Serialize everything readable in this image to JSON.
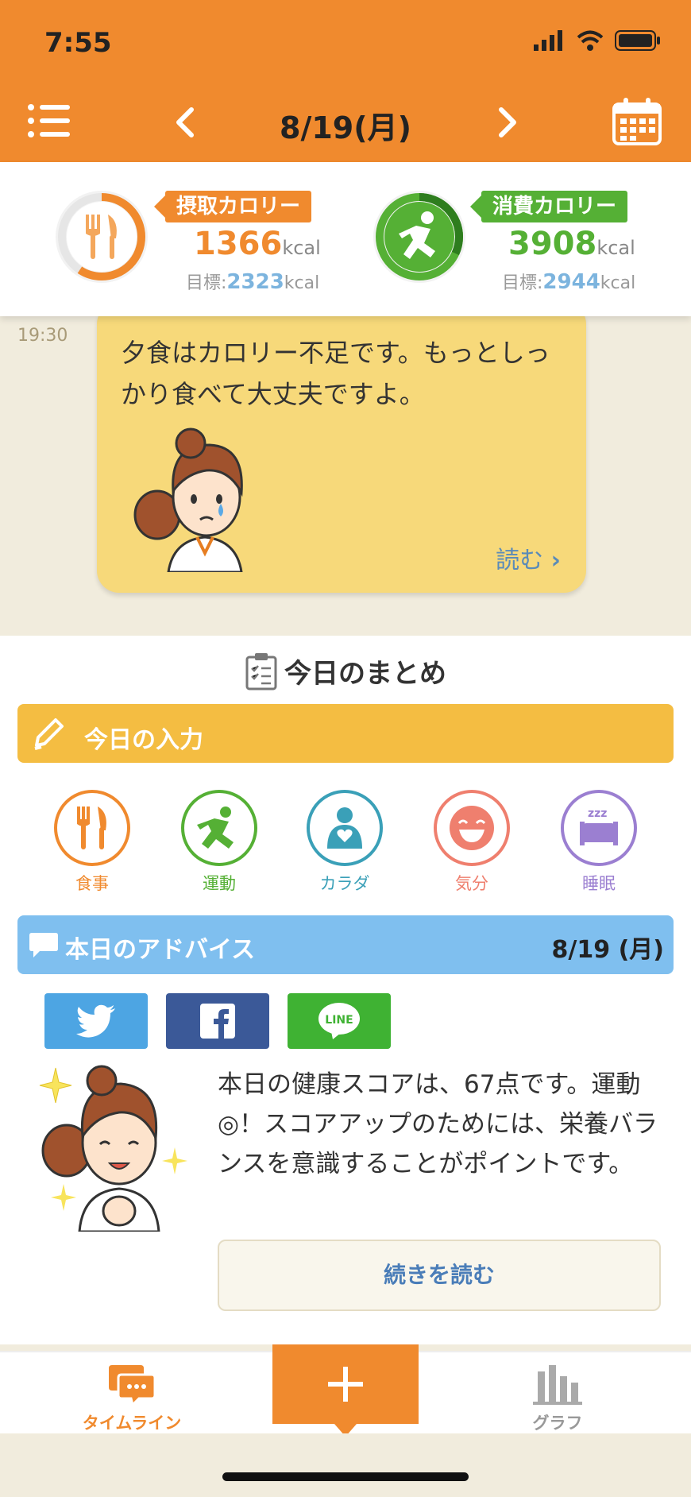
{
  "status_bar": {
    "time": "7:55"
  },
  "nav": {
    "title": "8/19(月)"
  },
  "calories": {
    "intake": {
      "label": "摂取カロリー",
      "value": "1366",
      "unit": "kcal",
      "goal_prefix": "目標:",
      "goal_value": "2323",
      "goal_unit": "kcal"
    },
    "burned": {
      "label": "消費カロリー",
      "value": "3908",
      "unit": "kcal",
      "goal_prefix": "目標:",
      "goal_value": "2944",
      "goal_unit": "kcal"
    }
  },
  "timeline": {
    "time": "19:30",
    "message": "夕食はカロリー不足です。もっとしっかり食べて大丈夫ですよ。",
    "read_more": "読む"
  },
  "summary": {
    "title": "今日のまとめ",
    "input_title": "今日の入力",
    "categories": [
      {
        "label": "食事",
        "color": "#f08a2e"
      },
      {
        "label": "運動",
        "color": "#55b035"
      },
      {
        "label": "カラダ",
        "color": "#3aa0b8"
      },
      {
        "label": "気分",
        "color": "#ef7f6e"
      },
      {
        "label": "睡眠",
        "color": "#9b7fd1"
      }
    ],
    "advice_title": "本日のアドバイス",
    "advice_date": "8/19 (月)",
    "share": {
      "line_label": "LINE"
    },
    "advice_text": "本日の健康スコアは、67点です。運動◎！スコアアップのためには、栄養バランスを意識することがポイントです。",
    "continue_label": "続きを読む"
  },
  "tabbar": {
    "timeline_label": "タイムライン",
    "graph_label": "グラフ"
  },
  "colors": {
    "brand": "#f08a2e",
    "green": "#55b035",
    "blue": "#7fbfef",
    "yellow": "#f4bd42"
  }
}
